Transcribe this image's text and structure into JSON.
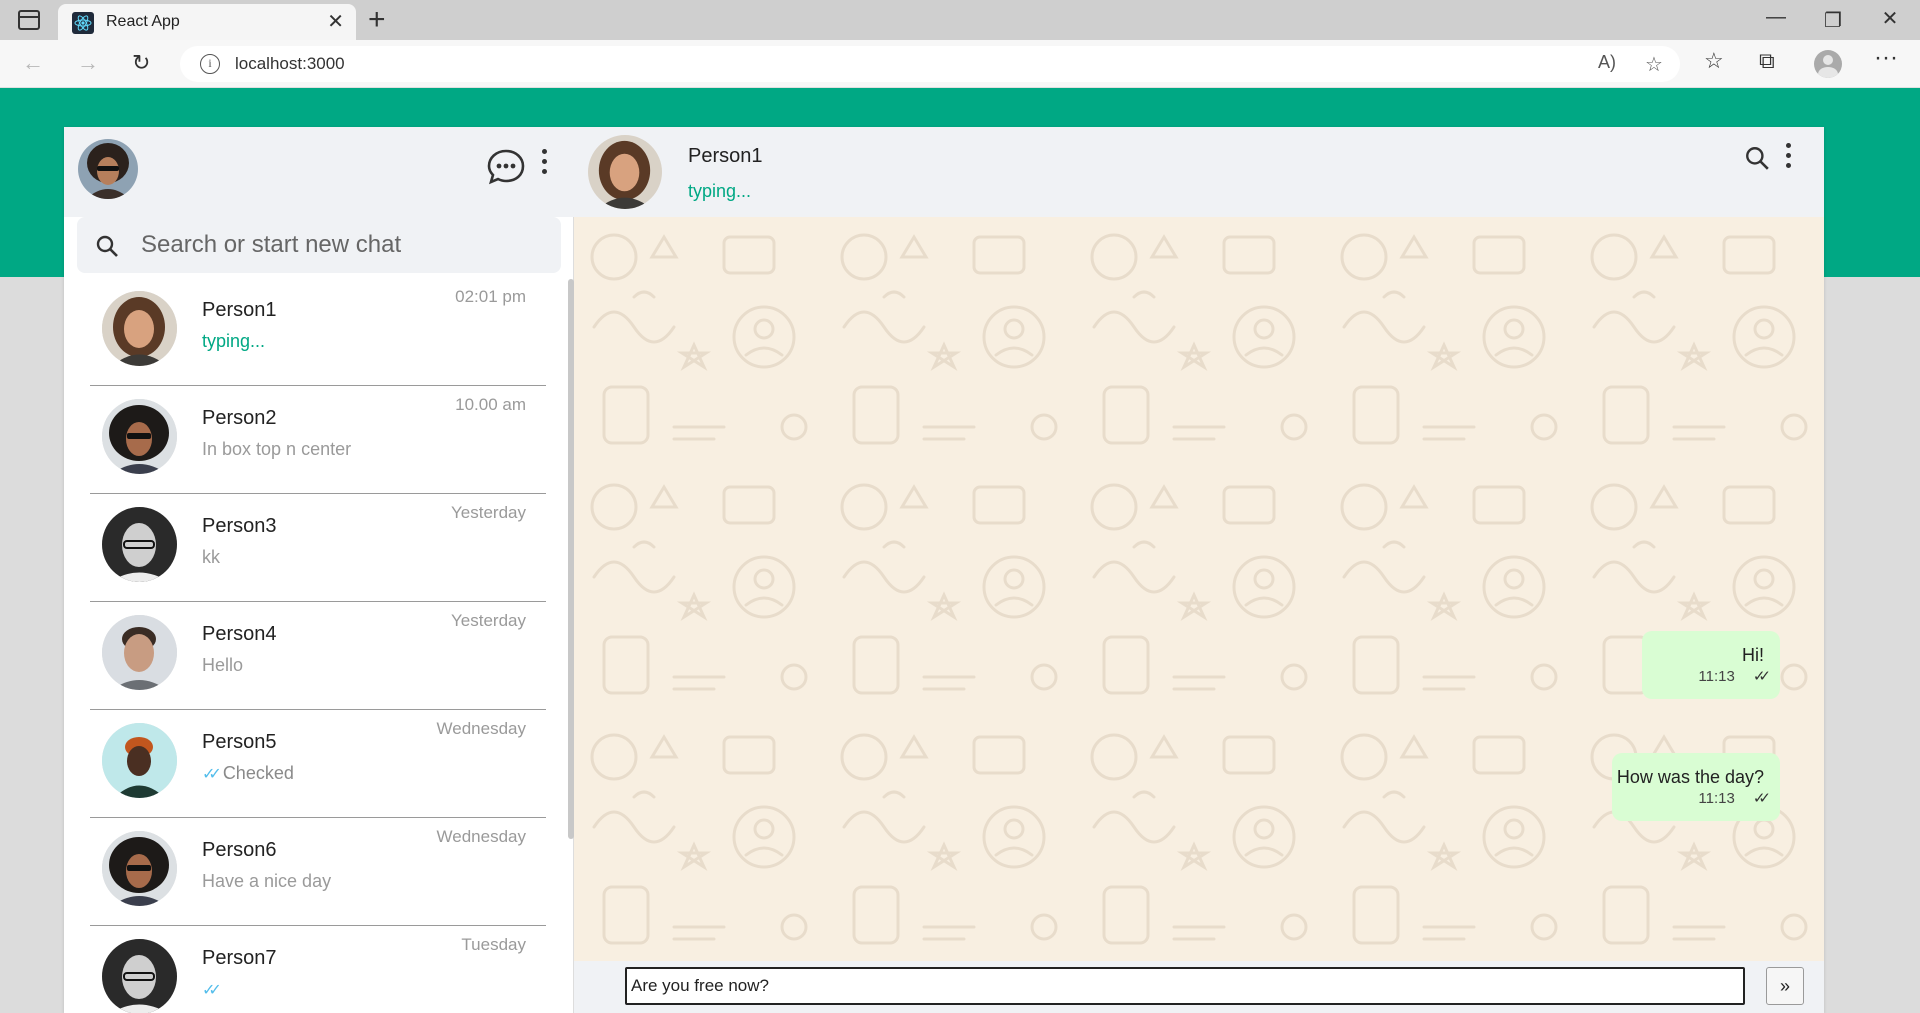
{
  "browser": {
    "tab_title": "React App",
    "url": "localhost:3000",
    "icons": {
      "back": "back-arrow-icon",
      "forward": "forward-arrow-icon",
      "refresh": "refresh-icon",
      "read_aloud": "read-aloud-icon",
      "add_favorite": "add-favorite-icon",
      "favorites": "favorites-icon",
      "collections": "collections-icon",
      "profile": "profile-icon",
      "more": "more-icon"
    }
  },
  "theme": {
    "accent": "#00a884",
    "header_bg": "#f0f2f5",
    "outgoing_bubble": "#d9fdd3",
    "wallpaper": "#f8efe1",
    "tick_blue": "#53bdeb"
  },
  "sidebar": {
    "search_placeholder": "Search or start new chat",
    "chats": [
      {
        "name": "Person1",
        "preview": "typing...",
        "time": "02:01 pm",
        "preview_style": "typing"
      },
      {
        "name": "Person2",
        "preview": "In box top n center",
        "time": "10.00 am",
        "preview_style": "normal"
      },
      {
        "name": "Person3",
        "preview": "kk",
        "time": "Yesterday",
        "preview_style": "normal"
      },
      {
        "name": "Person4",
        "preview": "Hello",
        "time": "Yesterday",
        "preview_style": "normal"
      },
      {
        "name": "Person5",
        "preview": "Checked",
        "time": "Wednesday",
        "preview_style": "ticks"
      },
      {
        "name": "Person6",
        "preview": "Have a nice day",
        "time": "Wednesday",
        "preview_style": "normal"
      },
      {
        "name": "Person7",
        "preview": "",
        "time": "Tuesday",
        "preview_style": "ticks"
      }
    ]
  },
  "conversation": {
    "contact_name": "Person1",
    "contact_status": "typing...",
    "messages": [
      {
        "text": "Hi!",
        "time": "11:13",
        "direction": "outgoing"
      },
      {
        "text": "How was the day?",
        "time": "11:13",
        "direction": "outgoing"
      }
    ],
    "composer_value": "Are you free now?",
    "send_label": "»"
  }
}
